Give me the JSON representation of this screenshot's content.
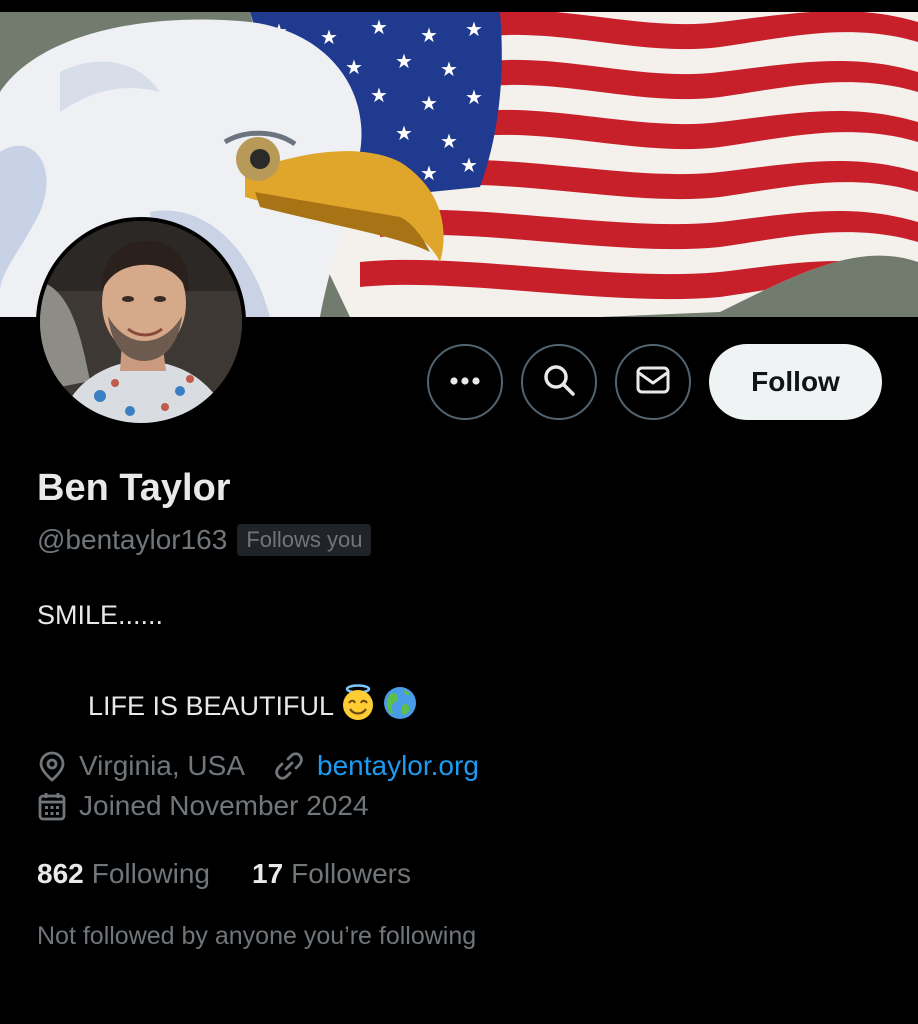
{
  "profile": {
    "name": "Ben Taylor",
    "handle": "@bentaylor163",
    "follows_you": "Follows you",
    "bio_line1": "SMILE......",
    "bio_line2": "LIFE IS BEAUTIFUL",
    "bio_emojis": [
      "smiling-face-with-halo",
      "globe-americas"
    ],
    "location": "Virginia, USA",
    "website": "bentaylor.org",
    "joined": "Joined November 2024",
    "following_count": "862",
    "following_label": "Following",
    "followers_count": "17",
    "followers_label": "Followers",
    "social_context": "Not followed by anyone you’re following"
  },
  "actions": {
    "more_icon": "more-horizontal-icon",
    "search_icon": "search-icon",
    "message_icon": "envelope-icon",
    "follow_label": "Follow"
  },
  "icons": {
    "location": "location-pin-icon",
    "link": "link-icon",
    "calendar": "calendar-icon"
  },
  "colors": {
    "background": "#000000",
    "primary_text": "#e7e9ea",
    "secondary_text": "#71767b",
    "link": "#1d9bf0",
    "follow_button_bg": "#eff3f4",
    "button_border": "#536471"
  }
}
